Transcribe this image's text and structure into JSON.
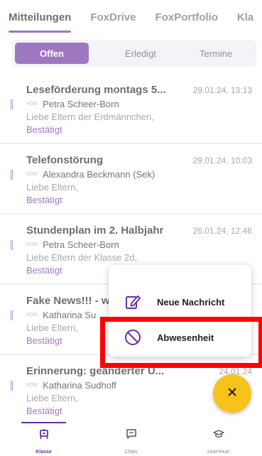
{
  "top_tabs": [
    {
      "label": "Mitteilungen",
      "active": true
    },
    {
      "label": "FoxDrive",
      "active": false
    },
    {
      "label": "FoxPortfolio",
      "active": false
    },
    {
      "label": "Kla",
      "active": false
    }
  ],
  "segments": [
    {
      "label": "Offen",
      "active": true
    },
    {
      "label": "Erledigt",
      "active": false
    },
    {
      "label": "Termine",
      "active": false
    }
  ],
  "messages": [
    {
      "title": "Leseförderung montags 5...",
      "date": "29.01.24, 13:13",
      "von": "VON",
      "from": "Petra Scheer-Born",
      "preview": "Liebe Eltern der Erdmännchen,",
      "status": "Bestätigt"
    },
    {
      "title": "Telefonstörung",
      "date": "29.01.24, 10:03",
      "von": "VON",
      "from": "Alexandra Beckmann (Sek)",
      "preview": "Liebe Eltern,",
      "status": "Bestätigt"
    },
    {
      "title": "Stundenplan im 2. Halbjahr",
      "date": "26.01.24, 12:46",
      "von": "VON",
      "from": "Petra Scheer-Born",
      "preview": "Liebe Eltern der Klasse 2d,",
      "status": "Bestätigt"
    },
    {
      "title": "Fake News!!! - w",
      "date": "",
      "von": "VON",
      "from": "Katharina Su",
      "preview": "Liebe Eltern,",
      "status": "Bestätigt"
    },
    {
      "title": "Erinnerung: geänderter U...",
      "date": "24.01.24",
      "von": "VON",
      "from": "Katharina Sudhoff",
      "preview": "Liebe Eltern,",
      "status": "Bestätigt"
    }
  ],
  "popup": {
    "new_message": "Neue Nachricht",
    "absence": "Abwesenheit"
  },
  "bottom_nav": [
    {
      "label": "Klasse",
      "icon": "class-icon",
      "active": true
    },
    {
      "label": "Chats",
      "icon": "chat-icon",
      "active": false
    },
    {
      "label": "LearnHub",
      "icon": "graduation-cap-icon",
      "active": false
    }
  ],
  "colors": {
    "accent": "#6a2fa0",
    "fab": "#f7c31a",
    "highlight": "#ff0000"
  }
}
